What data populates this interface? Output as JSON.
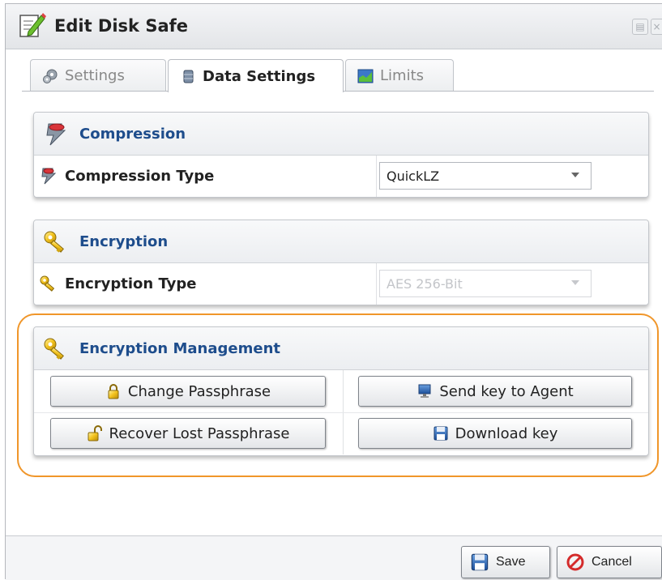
{
  "window": {
    "title": "Edit Disk Safe",
    "controls": [
      "restore",
      "close"
    ]
  },
  "tabs": [
    {
      "label": "Settings",
      "icon": "gear-icon",
      "active": false
    },
    {
      "label": "Data Settings",
      "icon": "database-icon",
      "active": true
    },
    {
      "label": "Limits",
      "icon": "chart-icon",
      "active": false
    }
  ],
  "compression": {
    "header": "Compression",
    "field_label": "Compression Type",
    "value": "QuickLZ"
  },
  "encryption": {
    "header": "Encryption",
    "field_label": "Encryption Type",
    "value": "AES 256-Bit",
    "disabled": true
  },
  "encryption_management": {
    "header": "Encryption Management",
    "buttons": {
      "change_passphrase": "Change Passphrase",
      "send_key": "Send key to Agent",
      "recover_passphrase": "Recover Lost Passphrase",
      "download_key": "Download key"
    }
  },
  "footer": {
    "save": "Save",
    "cancel": "Cancel"
  },
  "colors": {
    "section_header": "#1e4d8c",
    "highlight": "#f0962a"
  }
}
